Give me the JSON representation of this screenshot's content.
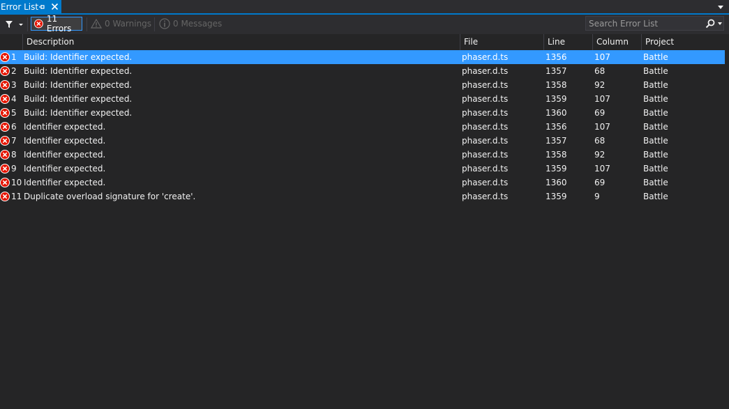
{
  "window": {
    "title": "Error List"
  },
  "toolbar": {
    "errors_label": "11 Errors",
    "warnings_label": "0 Warnings",
    "messages_label": "0 Messages",
    "search_placeholder": "Search Error List"
  },
  "columns": {
    "description": "Description",
    "file": "File",
    "line": "Line",
    "column": "Column",
    "project": "Project"
  },
  "colors": {
    "accent": "#007acc",
    "selection": "#3399ff",
    "error_icon": "#e51400",
    "background": "#252526"
  },
  "rows": [
    {
      "num": "1",
      "description": "Build: Identifier expected.",
      "file": "phaser.d.ts",
      "line": "1356",
      "column": "107",
      "project": "Battle",
      "icon": "error-icon"
    },
    {
      "num": "2",
      "description": "Build: Identifier expected.",
      "file": "phaser.d.ts",
      "line": "1357",
      "column": "68",
      "project": "Battle",
      "icon": "error-icon"
    },
    {
      "num": "3",
      "description": "Build: Identifier expected.",
      "file": "phaser.d.ts",
      "line": "1358",
      "column": "92",
      "project": "Battle",
      "icon": "error-icon"
    },
    {
      "num": "4",
      "description": "Build: Identifier expected.",
      "file": "phaser.d.ts",
      "line": "1359",
      "column": "107",
      "project": "Battle",
      "icon": "error-icon"
    },
    {
      "num": "5",
      "description": "Build: Identifier expected.",
      "file": "phaser.d.ts",
      "line": "1360",
      "column": "69",
      "project": "Battle",
      "icon": "error-icon"
    },
    {
      "num": "6",
      "description": "Identifier expected.",
      "file": "phaser.d.ts",
      "line": "1356",
      "column": "107",
      "project": "Battle",
      "icon": "error-icon"
    },
    {
      "num": "7",
      "description": "Identifier expected.",
      "file": "phaser.d.ts",
      "line": "1357",
      "column": "68",
      "project": "Battle",
      "icon": "error-icon"
    },
    {
      "num": "8",
      "description": "Identifier expected.",
      "file": "phaser.d.ts",
      "line": "1358",
      "column": "92",
      "project": "Battle",
      "icon": "error-icon"
    },
    {
      "num": "9",
      "description": "Identifier expected.",
      "file": "phaser.d.ts",
      "line": "1359",
      "column": "107",
      "project": "Battle",
      "icon": "error-icon"
    },
    {
      "num": "10",
      "description": "Identifier expected.",
      "file": "phaser.d.ts",
      "line": "1360",
      "column": "69",
      "project": "Battle",
      "icon": "error-icon"
    },
    {
      "num": "11",
      "description": "Duplicate overload signature for 'create'.",
      "file": "phaser.d.ts",
      "line": "1359",
      "column": "9",
      "project": "Battle",
      "icon": "error-icon"
    }
  ]
}
